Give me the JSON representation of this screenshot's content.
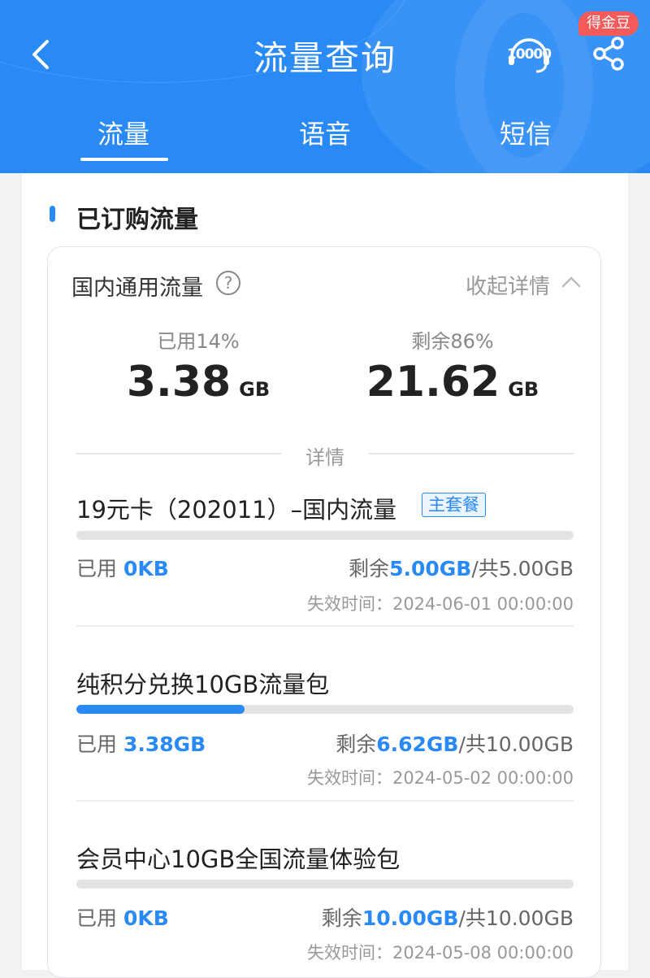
{
  "header": {
    "title": "流量查询",
    "cs_icon_text": "10000",
    "coin_badge": "得金豆",
    "tabs": [
      {
        "label": "流量",
        "active": true
      },
      {
        "label": "语音",
        "active": false
      },
      {
        "label": "短信",
        "active": false
      }
    ],
    "colors": {
      "brand": "#2a8af5"
    }
  },
  "section": {
    "title": "已订购流量"
  },
  "summary": {
    "title": "国内通用流量",
    "collapse_label": "收起详情",
    "used_label": "已用14%",
    "used_value": "3.38",
    "used_unit": "GB",
    "remain_label": "剩余86%",
    "remain_value": "21.62",
    "remain_unit": "GB",
    "details_label": "详情"
  },
  "packages": [
    {
      "name": "19元卡（202011）–国内流量",
      "tag": "主套餐",
      "used_prefix": "已用 ",
      "used": "0KB",
      "remain_prefix": "剩余",
      "remain": "5.00GB",
      "total": "/共5.00GB",
      "expire": "失效时间：2024-06-01 00:00:00",
      "progress": 0
    },
    {
      "name": "纯积分兑换10GB流量包",
      "tag": "",
      "used_prefix": "已用 ",
      "used": "3.38GB",
      "remain_prefix": "剩余",
      "remain": "6.62GB",
      "total": "/共10.00GB",
      "expire": "失效时间：2024-05-02 00:00:00",
      "progress": 0.338
    },
    {
      "name": "会员中心10GB全国流量体验包",
      "tag": "",
      "used_prefix": "已用 ",
      "used": "0KB",
      "remain_prefix": "剩余",
      "remain": "10.00GB",
      "total": "/共10.00GB",
      "expire": "失效时间：2024-05-08 00:00:00",
      "progress": 0
    }
  ]
}
